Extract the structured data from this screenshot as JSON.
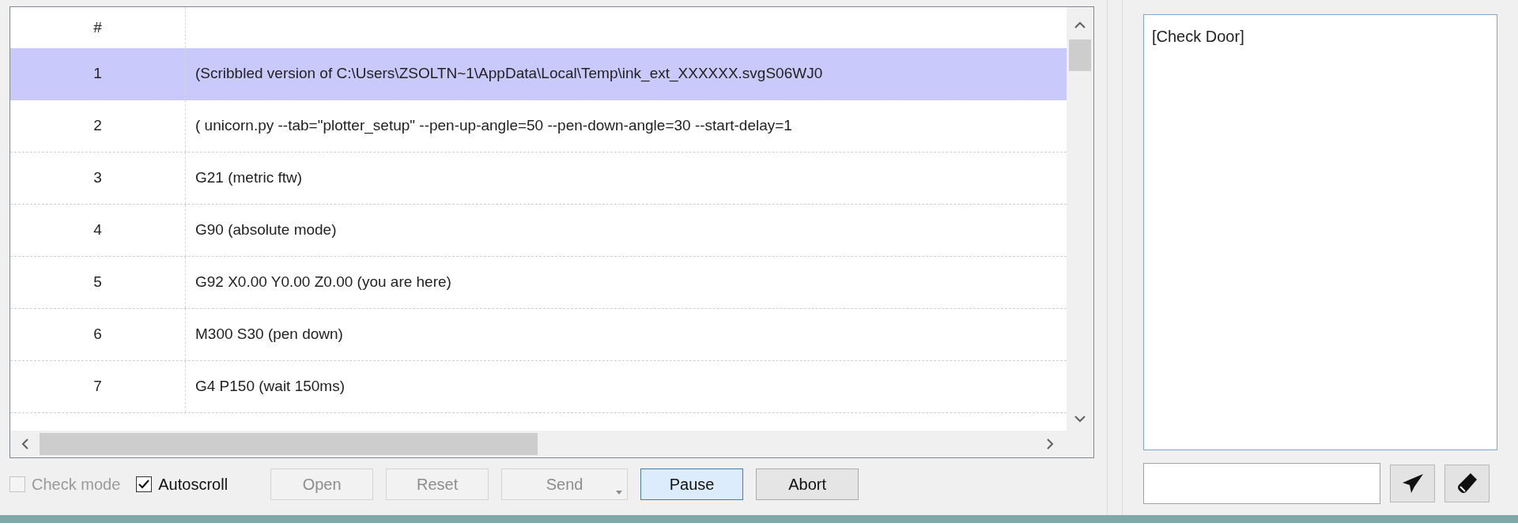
{
  "table": {
    "columns": [
      "#"
    ],
    "rows": [
      {
        "number": "1",
        "text": "(Scribbled version of C:\\Users\\ZSOLTN~1\\AppData\\Local\\Temp\\ink_ext_XXXXXX.svgS06WJ0",
        "selected": true
      },
      {
        "number": "2",
        "text": "( unicorn.py --tab=\"plotter_setup\" --pen-up-angle=50 --pen-down-angle=30 --start-delay=1",
        "selected": false
      },
      {
        "number": "3",
        "text": "G21 (metric ftw)",
        "selected": false
      },
      {
        "number": "4",
        "text": "G90 (absolute mode)",
        "selected": false
      },
      {
        "number": "5",
        "text": "G92 X0.00 Y0.00 Z0.00 (you are here)",
        "selected": false
      },
      {
        "number": "6",
        "text": "M300 S30 (pen down)",
        "selected": false
      },
      {
        "number": "7",
        "text": "G4 P150 (wait 150ms)",
        "selected": false
      }
    ]
  },
  "options": [
    {
      "label": "Check mode",
      "checked": false,
      "disabled": true
    },
    {
      "label": "Autoscroll",
      "checked": true,
      "disabled": false
    }
  ],
  "buttons": [
    {
      "label": "Open",
      "disabled": true,
      "focused": false,
      "dropdown": false
    },
    {
      "label": "Reset",
      "disabled": true,
      "focused": false,
      "dropdown": false
    },
    {
      "label": "Send",
      "disabled": true,
      "focused": false,
      "dropdown": true
    },
    {
      "label": "Pause",
      "disabled": false,
      "focused": true,
      "dropdown": false
    },
    {
      "label": "Abort",
      "disabled": false,
      "focused": false,
      "dropdown": false
    }
  ],
  "console": {
    "log": "[Check Door]"
  }
}
